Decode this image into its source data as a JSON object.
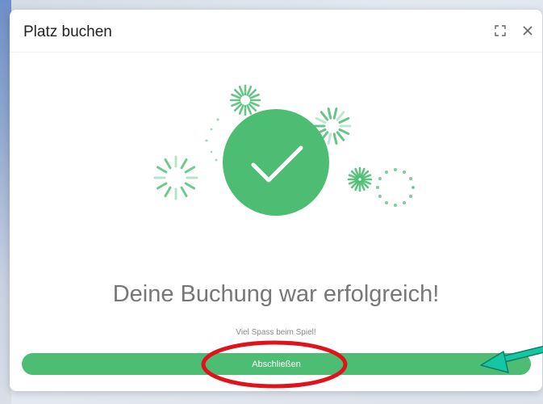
{
  "dialog": {
    "title": "Platz buchen",
    "expand_icon": "expand-icon",
    "close_icon": "close-icon"
  },
  "illustration": {
    "icon": "checkmark-icon",
    "color": "#4cbd73"
  },
  "message": {
    "headline": "Deine Buchung war erfolgreich!",
    "subline": "Viel Spass beim Spiel!"
  },
  "actions": {
    "finish_label": "Abschließen"
  },
  "colors": {
    "accent": "#4cbd73",
    "annotation_ring": "#e0131a",
    "annotation_arrow": "#14c7a2"
  }
}
